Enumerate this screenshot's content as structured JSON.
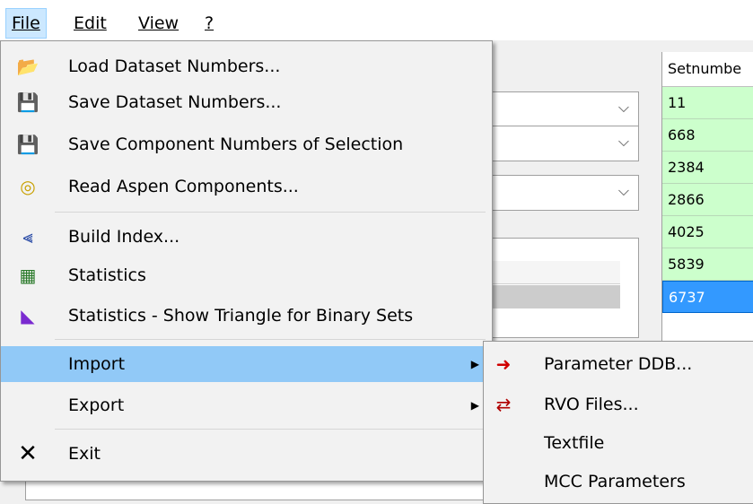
{
  "menubar": {
    "items": [
      {
        "label": "File",
        "active": true
      },
      {
        "label": "Edit"
      },
      {
        "label": "View"
      },
      {
        "label": "?"
      }
    ]
  },
  "file_menu": {
    "items": [
      {
        "label": "Load Dataset Numbers...",
        "icon": "open-folder-icon"
      },
      {
        "label": "Save Dataset Numbers...",
        "icon": "floppy-disk-icon"
      },
      {
        "label": "Save Component Numbers of Selection",
        "icon": "floppy-disk-icon"
      },
      {
        "label": "Read Aspen Components...",
        "icon": "aspen-icon"
      },
      {
        "label": "Build Index...",
        "icon": "tree-index-icon"
      },
      {
        "label": "Statistics",
        "icon": "grid-table-icon"
      },
      {
        "label": "Statistics - Show Triangle for Binary Sets",
        "icon": "triangle-icon"
      },
      {
        "label": "Import",
        "has_submenu": true,
        "highlighted": true
      },
      {
        "label": "Export",
        "has_submenu": true
      },
      {
        "label": "Exit",
        "icon": "close-icon"
      }
    ]
  },
  "import_submenu": {
    "items": [
      {
        "label": "Parameter DDB...",
        "icon": "import-arrow-icon"
      },
      {
        "label": "RVO Files...",
        "icon": "rvo-icon"
      },
      {
        "label": "Textfile"
      },
      {
        "label": "MCC Parameters"
      }
    ]
  },
  "table": {
    "header": "Setnumbe",
    "rows": [
      "11",
      "668",
      "2384",
      "2866",
      "4025",
      "5839",
      "6737"
    ],
    "selected_row": "6737"
  },
  "colors": {
    "highlight": "#91c9f7",
    "row_green": "#ccffcc",
    "row_selected": "#3399ff"
  }
}
